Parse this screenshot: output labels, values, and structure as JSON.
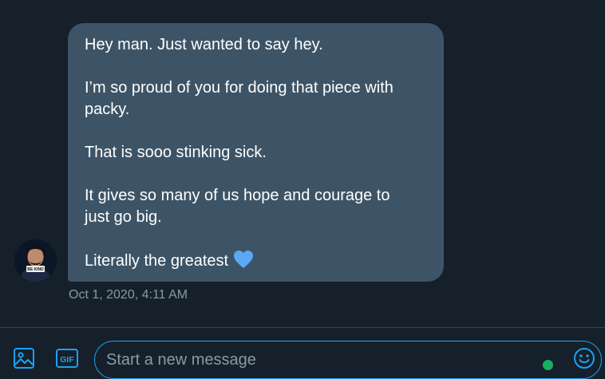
{
  "message": {
    "lines": [
      "Hey man. Just wanted to say hey.",
      "",
      "I’m so proud of you for doing that piece with",
      "packy.",
      "",
      "That is sooo stinking sick.",
      "",
      "It gives so many of us hope and courage to",
      "just go big.",
      "",
      "Literally the greatest"
    ],
    "timestamp": "Oct 1, 2020, 4:11 AM",
    "emoji_icon": "blue-heart-icon"
  },
  "avatar": {
    "shirt_text": "BE KIND"
  },
  "composer": {
    "placeholder": "Start a new message",
    "value": "",
    "gif_label": "GIF",
    "media_icon": "image-icon",
    "emoji_icon": "smiley-icon"
  },
  "colors": {
    "background": "#15202b",
    "bubble": "#3d5466",
    "accent": "#1da1f2",
    "muted_text": "#8899a6",
    "heart": "#5aa9f5",
    "status": "#17bf63"
  }
}
